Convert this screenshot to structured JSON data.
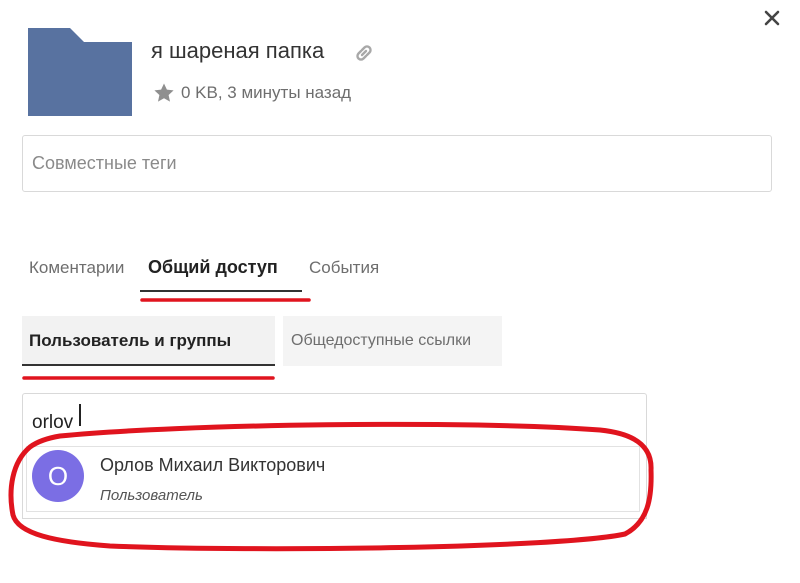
{
  "dialog": {
    "close_icon": "close-icon"
  },
  "folder": {
    "icon": "folder-icon",
    "color": "#5872a0",
    "name": "я шареная папка",
    "link_icon": "link-icon",
    "star_icon": "star-icon",
    "meta": "0 KB, 3 минуты назад"
  },
  "tags": {
    "placeholder": "Совместные теги"
  },
  "tabs": [
    {
      "label": "Коментарии",
      "active": false
    },
    {
      "label": "Общий доступ",
      "active": true
    },
    {
      "label": "События",
      "active": false
    }
  ],
  "subtabs": [
    {
      "label": "Пользователь и группы",
      "active": true
    },
    {
      "label": "Общедоступные ссылки",
      "active": false
    }
  ],
  "search": {
    "value": "orlov"
  },
  "suggestions": [
    {
      "initial": "О",
      "name": "Орлов Михаил Викторович",
      "role": "Пользователь",
      "avatar_color": "#7b6ee4"
    }
  ],
  "annotation_color": "#e0141e"
}
